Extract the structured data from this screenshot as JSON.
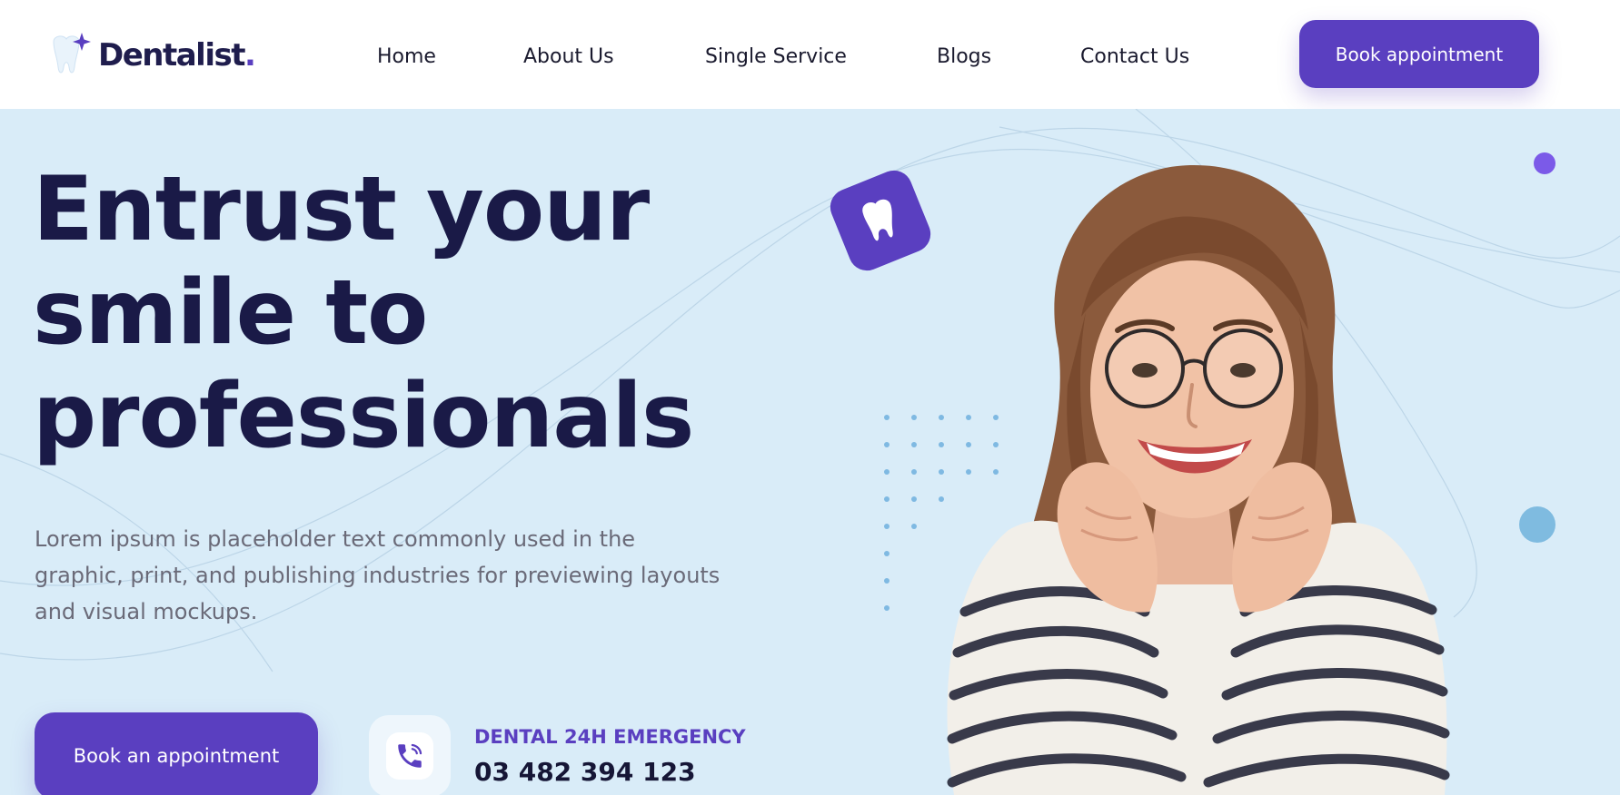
{
  "nav": {
    "brand": "Dentalist",
    "brand_dot": ".",
    "links": [
      "Home",
      "About Us",
      "Single Service",
      "Blogs",
      "Contact Us"
    ],
    "cta": "Book appointment"
  },
  "hero": {
    "headline": [
      "Entrust your",
      "smile to",
      "professionals"
    ],
    "lede": "Lorem ipsum is placeholder text commonly used in the graphic, print, and publishing industries for previewing layouts and visual mockups.",
    "cta": "Book an appointment",
    "emergency_label": "DENTAL 24H EMERGENCY",
    "emergency_phone": "03 482 394 123"
  },
  "icons": {
    "logo": "tooth-sparkle-icon",
    "phone": "phone-icon",
    "badge": "tooth-icon"
  },
  "colors": {
    "brand": "#5a3fc0",
    "hero_bg": "#d9ecf8",
    "heading": "#1a1a47",
    "accent_blue": "#7fbbe0",
    "accent_purple": "#7b5ae8"
  }
}
